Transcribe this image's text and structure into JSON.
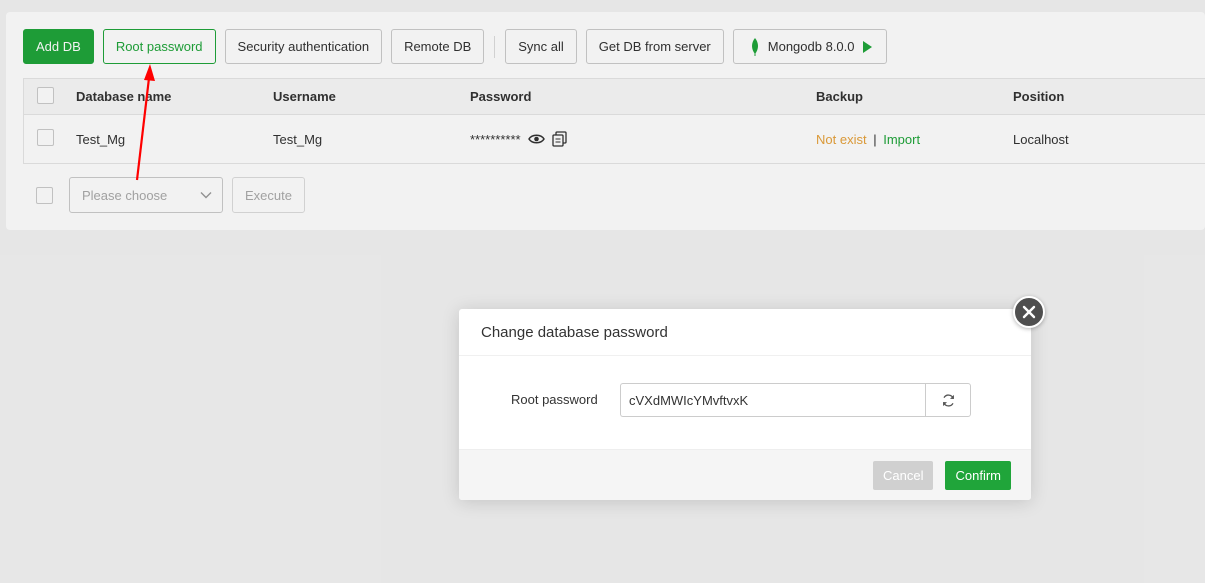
{
  "toolbar": {
    "add_db": "Add DB",
    "root_password": "Root password",
    "security_auth": "Security authentication",
    "remote_db": "Remote DB",
    "sync_all": "Sync all",
    "get_db_from_server": "Get DB from server",
    "mongodb_version": "Mongodb 8.0.0"
  },
  "table": {
    "headers": {
      "database_name": "Database name",
      "username": "Username",
      "password": "Password",
      "backup": "Backup",
      "position": "Position"
    },
    "rows": [
      {
        "database_name": "Test_Mg",
        "username": "Test_Mg",
        "password_mask": "**********",
        "backup_status": "Not exist",
        "backup_sep": "|",
        "backup_action": "Import",
        "position": "Localhost"
      }
    ]
  },
  "batch": {
    "select_placeholder": "Please choose",
    "execute": "Execute"
  },
  "modal": {
    "title": "Change database password",
    "field_label": "Root password",
    "field_value": "cVXdMWIcYMvftvxK",
    "cancel": "Cancel",
    "confirm": "Confirm"
  },
  "colors": {
    "accent": "#20a53a",
    "warning": "#e6a23c",
    "annotation": "#ff0000"
  },
  "icons": [
    "mongodb-leaf-icon",
    "play-icon",
    "eye-icon",
    "copy-icon",
    "chevron-down-icon",
    "refresh-icon",
    "close-icon"
  ]
}
